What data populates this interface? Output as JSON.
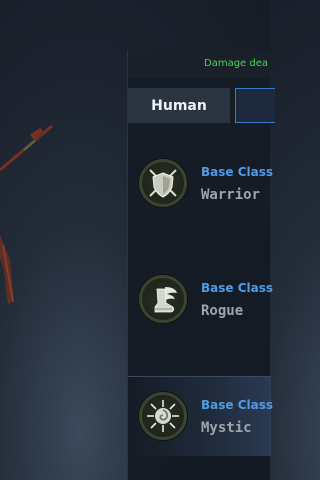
{
  "header": {
    "damage_text": "Damage dea"
  },
  "tabs": [
    {
      "label": "Human"
    },
    {
      "label": ""
    }
  ],
  "classes": [
    {
      "kicker": "Base Class",
      "name": "Warrior",
      "icon": "shield-swords-icon"
    },
    {
      "kicker": "Base Class",
      "name": "Rogue",
      "icon": "winged-boot-icon"
    },
    {
      "kicker": "Base Class",
      "name": "Mystic",
      "icon": "sun-spiral-icon"
    }
  ],
  "colors": {
    "accent_blue": "#4d9de8",
    "damage_green": "#4fd15f",
    "panel_bg": "#161c26"
  }
}
